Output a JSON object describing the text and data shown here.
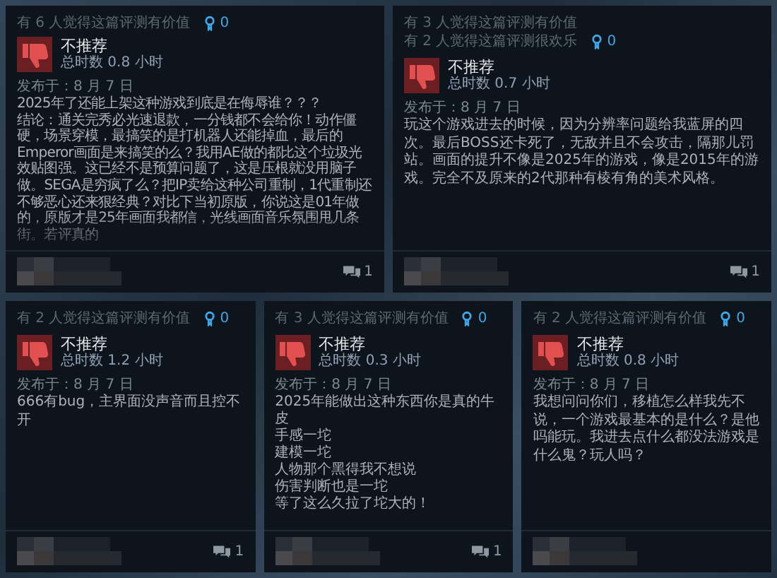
{
  "reviews": [
    {
      "helpful": [
        "有 6 人觉得这篇评测有价值"
      ],
      "awards": "0",
      "recommended": false,
      "verdict": "不推荐",
      "hours": "总时数 0.8 小时",
      "posted": "发布于：8 月 7 日",
      "faded": true,
      "body": [
        "2025年了还能上架这种游戏到底是在侮辱谁？？？",
        "结论：通关完秀必光速退款，一分钱都不会给你！动作僵硬，场景穿模，最搞笑的是打机器人还能掉血，最后的Emperor画面是来搞笑的么？我用AE做的都比这个垃圾光效贴图强。这已经不是预算问题了，这是压根就没用脑子做。SEGA是穷疯了么？把IP卖给这种公司重制，1代重制还不够恶心还来狠经典？对比下当初原版，你说这是01年做的，原版才是25年画面我都信，光线画面音乐氛围甩几条街。若评真的"
      ],
      "comments": "1"
    },
    {
      "helpful": [
        "有 3 人觉得这篇评测有价值",
        "有 2 人觉得这篇评测很欢乐"
      ],
      "awards": "0",
      "recommended": false,
      "verdict": "不推荐",
      "hours": "总时数 0.7 小时",
      "posted": "发布于：8 月 7 日",
      "body": [
        "玩这个游戏进去的时候，因为分辨率问题给我蓝屏的四次。最后BOSS还卡死了，无敌并且不会攻击，隔那儿罚站。画面的提升不像是2025年的游戏，像是2015年的游戏。完全不及原来的2代那种有棱有角的美术风格。"
      ],
      "comments": "1"
    },
    {
      "helpful": [
        "有 2 人觉得这篇评测有价值"
      ],
      "awards": "0",
      "recommended": false,
      "verdict": "不推荐",
      "hours": "总时数 1.2 小时",
      "posted": "发布于：8 月 7 日",
      "body": [
        "666有bug，主界面没声音而且控不开"
      ],
      "comments": "1"
    },
    {
      "helpful": [
        "有 3 人觉得这篇评测有价值"
      ],
      "awards": "0",
      "recommended": false,
      "verdict": "不推荐",
      "hours": "总时数 0.3 小时",
      "posted": "发布于：8 月 7 日",
      "body": [
        "2025年能做出这种东西你是真的牛皮",
        "手感一坨",
        "建模一坨",
        "人物那个黑得我不想说",
        "伤害判断也是一坨",
        "等了这么久拉了坨大的！"
      ],
      "comments": "1"
    },
    {
      "helpful": [
        "有 2 人觉得这篇评测有价值"
      ],
      "awards": "0",
      "recommended": false,
      "verdict": "不推荐",
      "hours": "总时数 0.8 小时",
      "posted": "发布于：8 月 7 日",
      "body": [
        "我想问问你们，移植怎么样我先不说，一个游戏最基本的是什么？是他吗能玩。我进去点什么都没法游戏是什么鬼？玩人吗？"
      ]
    }
  ]
}
